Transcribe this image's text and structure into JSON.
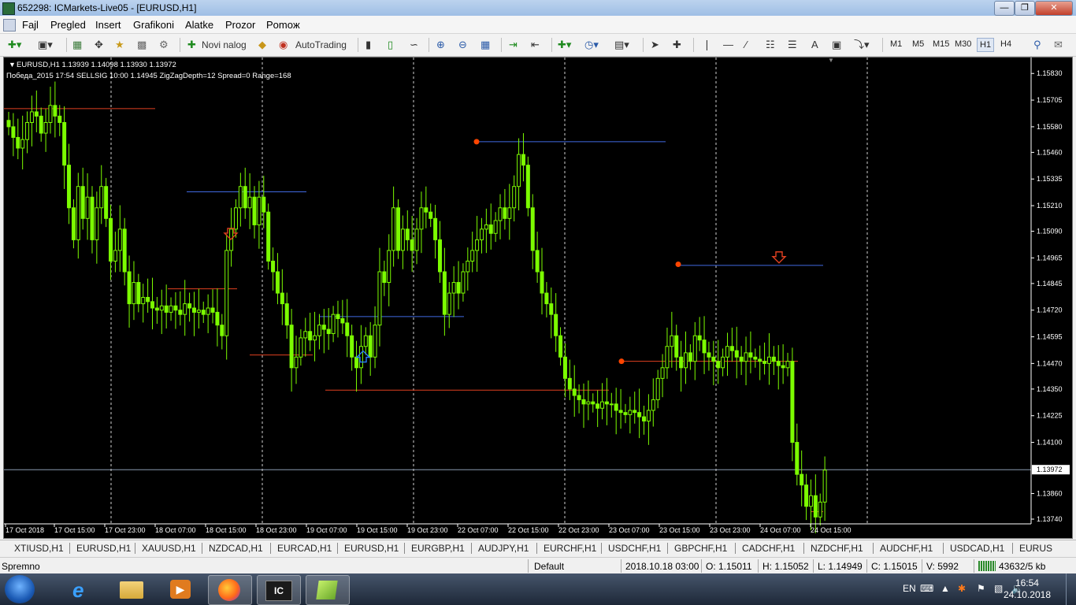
{
  "window": {
    "title": "652298: ICMarkets-Live05 - [EURUSD,H1]"
  },
  "menu": {
    "items": [
      "Fajl",
      "Pregled",
      "Insert",
      "Grafikoni",
      "Alatke",
      "Prozor",
      "Pomoж"
    ]
  },
  "toolbar": {
    "new_order_label": "Novi nalog",
    "autotrading_label": "AutoTrading",
    "timeframes": [
      "M1",
      "M5",
      "M15",
      "M30",
      "H1",
      "H4"
    ],
    "active_timeframe": "H1"
  },
  "chart": {
    "header_line1": "EURUSD,H1  1.13939 1.14098 1.13930 1.13972",
    "header_line2": "Победа_2015  17:54  SELLSIG  10:00  1.14945  ZigZagDepth=12  Spread=0  Range=168",
    "current_price_label": "1.13972",
    "colors": {
      "background": "#000000",
      "candle": "#7cfc00",
      "resistance_line": "#4169e1",
      "support_line": "#e04020",
      "zigzag_dot": "#ff4500",
      "sell_arrow": "#e04020",
      "buy_arrow": "#2a7fff",
      "price_line": "#8a9ab0"
    },
    "icons": {
      "sell_arrow": "down-arrow-icon",
      "buy_arrow": "up-arrow-icon"
    }
  },
  "chart_data": {
    "type": "candlestick",
    "symbol": "EURUSD",
    "timeframe": "H1",
    "y_ticks": [
      "1.15830",
      "1.15705",
      "1.15580",
      "1.15460",
      "1.15335",
      "1.15210",
      "1.15090",
      "1.14965",
      "1.14845",
      "1.14720",
      "1.14595",
      "1.14470",
      "1.14350",
      "1.14225",
      "1.14100",
      "1.13972",
      "1.13860",
      "1.13740"
    ],
    "ylim": [
      1.1374,
      1.1589
    ],
    "x_ticks": [
      "17 Oct 2018",
      "17 Oct 15:00",
      "17 Oct 23:00",
      "18 Oct 07:00",
      "18 Oct 15:00",
      "18 Oct 23:00",
      "19 Oct 07:00",
      "19 Oct 15:00",
      "19 Oct 23:00",
      "22 Oct 07:00",
      "22 Oct 15:00",
      "22 Oct 23:00",
      "23 Oct 07:00",
      "23 Oct 15:00",
      "23 Oct 23:00",
      "24 Oct 07:00",
      "24 Oct 15:00"
    ],
    "closes": [
      1.1558,
      1.1553,
      1.1548,
      1.1552,
      1.156,
      1.1565,
      1.1563,
      1.1555,
      1.156,
      1.1568,
      1.1563,
      1.156,
      1.154,
      1.152,
      1.1505,
      1.153,
      1.1515,
      1.1525,
      1.1505,
      1.152,
      1.153,
      1.1515,
      1.1495,
      1.15,
      1.151,
      1.149,
      1.1475,
      1.1485,
      1.1475,
      1.1478,
      1.1476,
      1.1473,
      1.1472,
      1.1474,
      1.1471,
      1.1474,
      1.1472,
      1.147,
      1.1475,
      1.1473,
      1.1471,
      1.1472,
      1.147,
      1.1473,
      1.1471,
      1.1465,
      1.146,
      1.15,
      1.151,
      1.152,
      1.153,
      1.152,
      1.1525,
      1.1512,
      1.1525,
      1.1518,
      1.1495,
      1.149,
      1.148,
      1.1475,
      1.1465,
      1.1445,
      1.145,
      1.1459,
      1.1462,
      1.1458,
      1.146,
      1.1465,
      1.1463,
      1.1461,
      1.147,
      1.1468,
      1.1466,
      1.146,
      1.145,
      1.1445,
      1.1455,
      1.146,
      1.145,
      1.1465,
      1.149,
      1.1485,
      1.15,
      1.152,
      1.15,
      1.151,
      1.1505,
      1.15,
      1.151,
      1.152,
      1.1518,
      1.1515,
      1.1505,
      1.149,
      1.147,
      1.148,
      1.1485,
      1.148,
      1.149,
      1.1495,
      1.15,
      1.1505,
      1.151,
      1.1512,
      1.1508,
      1.1514,
      1.152,
      1.1515,
      1.152,
      1.153,
      1.1545,
      1.154,
      1.152,
      1.15,
      1.149,
      1.148,
      1.1475,
      1.147,
      1.146,
      1.145,
      1.144,
      1.1435,
      1.1432,
      1.143,
      1.1428,
      1.1429,
      1.1428,
      1.1426,
      1.1429,
      1.1428,
      1.1428,
      1.1425,
      1.1424,
      1.1423,
      1.1425,
      1.1424,
      1.1422,
      1.142,
      1.1425,
      1.143,
      1.144,
      1.1445,
      1.1455,
      1.146,
      1.145,
      1.1445,
      1.1452,
      1.1448,
      1.146,
      1.1458,
      1.1452,
      1.145,
      1.1448,
      1.1445,
      1.145,
      1.1455,
      1.1453,
      1.145,
      1.1448,
      1.1452,
      1.145,
      1.1449,
      1.1448,
      1.1447,
      1.145,
      1.1448,
      1.1446,
      1.1445,
      1.1448,
      1.141,
      1.1395,
      1.139,
      1.138,
      1.1385,
      1.1375,
      1.1382,
      1.1397
    ]
  },
  "tabs": [
    "XTIUSD,H1",
    "EURUSD,H1",
    "XAUUSD,H1",
    "NZDCAD,H1",
    "EURCAD,H1",
    "EURUSD,H1",
    "EURGBP,H1",
    "AUDJPY,H1",
    "EURCHF,H1",
    "USDCHF,H1",
    "GBPCHF,H1",
    "CADCHF,H1",
    "NZDCHF,H1",
    "AUDCHF,H1",
    "USDCAD,H1",
    "EURUS"
  ],
  "status": {
    "ready": "Spremno",
    "profile": "Default",
    "datetime": "2018.10.18 03:00",
    "open": "O: 1.15011",
    "high": "H: 1.15052",
    "low": "L: 1.14949",
    "close": "C: 1.15015",
    "volume": "V: 5992",
    "traffic": "43632/5 kb"
  },
  "taskbar": {
    "language": "EN",
    "time": "16:54",
    "date": "24.10.2018"
  }
}
